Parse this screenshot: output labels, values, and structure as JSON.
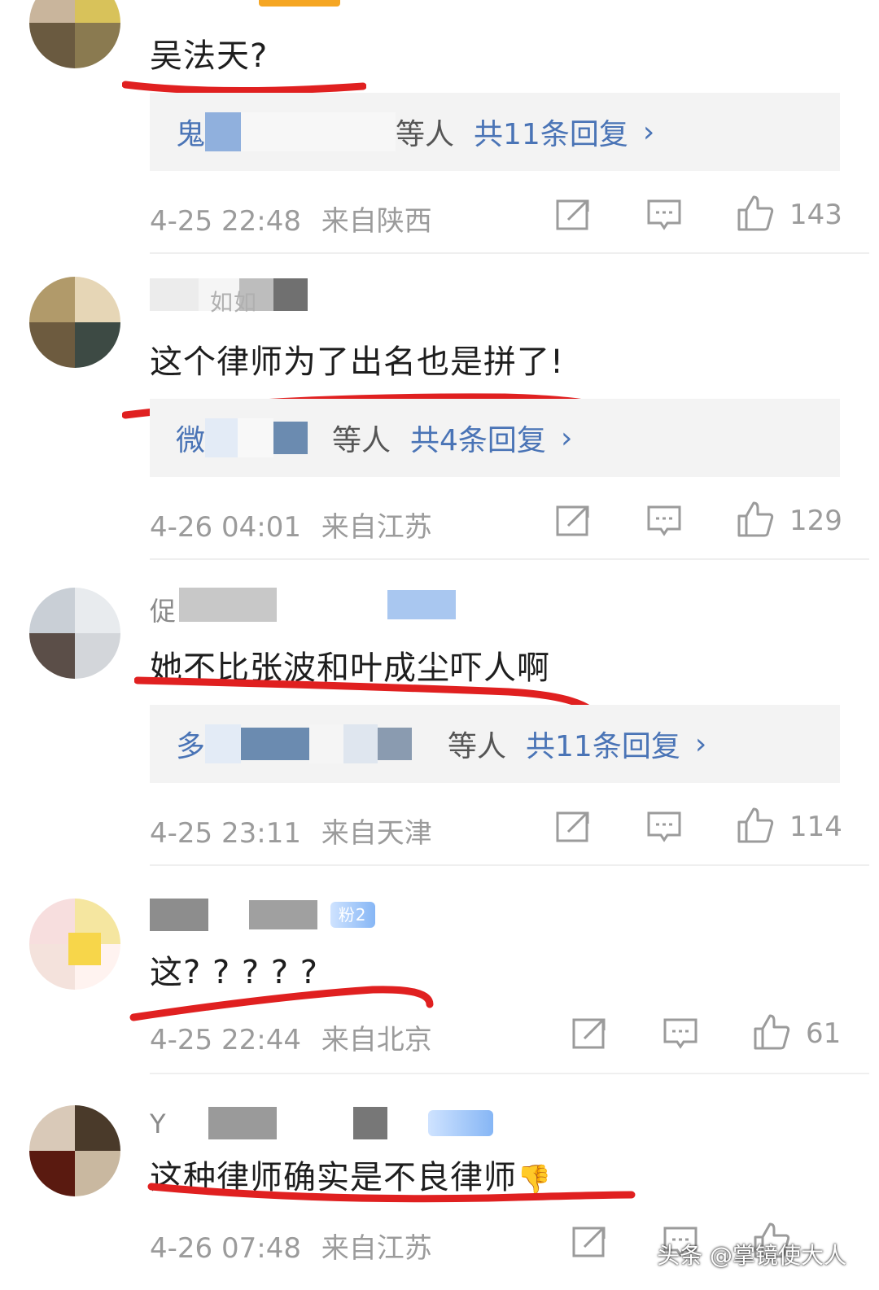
{
  "comments": [
    {
      "text": "吴法天?",
      "reply_prefix": "鬼",
      "reply_suffix": "等人",
      "reply_count": "共11条回复",
      "chevron": "›",
      "time": "4-25 22:48",
      "location": "来自陕西",
      "likes": "143"
    },
    {
      "username_fragment": "如如",
      "text": "这个律师为了出名也是拼了!",
      "reply_prefix": "微",
      "reply_suffix": "等人",
      "reply_count": "共4条回复",
      "chevron": "›",
      "time": "4-26 04:01",
      "location": "来自江苏",
      "likes": "129"
    },
    {
      "username_fragment": "促",
      "text": "她不比张波和叶成尘吓人啊",
      "reply_prefix": "多",
      "reply_suffix": "等人",
      "reply_count": "共11条回复",
      "chevron": "›",
      "time": "4-25 23:11",
      "location": "来自天津",
      "likes": "114"
    },
    {
      "badge": "粉2",
      "text": "这? ? ? ? ?",
      "time": "4-25 22:44",
      "location": "来自北京",
      "likes": "61"
    },
    {
      "username_fragment": "Y",
      "badge": "",
      "text": "这种律师确实是不良律师",
      "emoji": "👎",
      "time": "4-26 07:48",
      "location": "来自江苏",
      "likes": ""
    }
  ],
  "icons": {
    "share": "share-icon",
    "comment": "comment-icon",
    "like": "thumbs-up-icon"
  },
  "watermark": "头条 @掌镜使大人",
  "colors": {
    "link": "#4a74b6",
    "meta": "#9b9b9b",
    "underline": "#e02020",
    "reply_bg": "#f3f3f3"
  }
}
